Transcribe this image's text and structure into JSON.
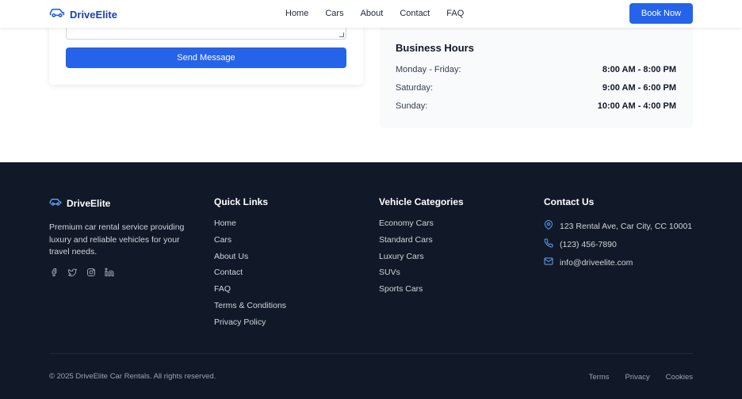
{
  "brand": {
    "name": "DriveElite",
    "accent": "#2563eb",
    "icon": "car-icon"
  },
  "nav": {
    "links": [
      "Home",
      "Cars",
      "About",
      "Contact",
      "FAQ"
    ],
    "cta": "Book Now"
  },
  "contact_form": {
    "message_value": "",
    "submit_label": "Send Message"
  },
  "business_hours": {
    "title": "Business Hours",
    "rows": [
      {
        "day": "Monday - Friday:",
        "time": "8:00 AM - 8:00 PM"
      },
      {
        "day": "Saturday:",
        "time": "9:00 AM - 6:00 PM"
      },
      {
        "day": "Sunday:",
        "time": "10:00 AM - 4:00 PM"
      }
    ]
  },
  "footer": {
    "brand_name": "DriveElite",
    "description": "Premium car rental service providing luxury and reliable vehicles for your travel needs.",
    "socials": [
      "facebook-icon",
      "twitter-icon",
      "instagram-icon",
      "linkedin-icon"
    ],
    "quick_links": {
      "title": "Quick Links",
      "items": [
        "Home",
        "Cars",
        "About Us",
        "Contact",
        "FAQ",
        "Terms & Conditions",
        "Privacy Policy"
      ]
    },
    "categories": {
      "title": "Vehicle Categories",
      "items": [
        "Economy Cars",
        "Standard Cars",
        "Luxury Cars",
        "SUVs",
        "Sports Cars"
      ]
    },
    "contact": {
      "title": "Contact Us",
      "address": "123 Rental Ave, Car City, CC 10001",
      "phone": "(123) 456-7890",
      "email": "info@driveelite.com"
    },
    "copyright": "© 2025 DriveElite Car Rentals. All rights reserved.",
    "legal_links": [
      "Terms",
      "Privacy",
      "Cookies"
    ]
  },
  "colors": {
    "footer_bg": "#111827",
    "primary": "#2563eb"
  }
}
